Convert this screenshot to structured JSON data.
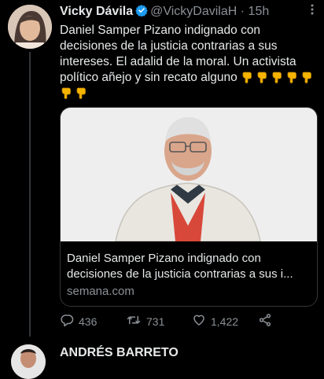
{
  "tweet": {
    "author": "Vicky Dávila",
    "handle": "@VickyDavilaH",
    "separator": "·",
    "time": "15h",
    "text_main": "Daniel Samper Pizano indignado con decisiones de la justicia contrarias a sus intereses. El adalid  de la moral. Un activista político añejo y sin recato alguno",
    "emoji_count": 7,
    "card": {
      "title": "Daniel Samper Pizano indignado con decisiones de la justicia contrarias a sus i...",
      "domain": "semana.com"
    },
    "replies": "436",
    "retweets": "731",
    "likes": "1,422"
  },
  "next_tweet": {
    "author": "ANDRÉS BARRETO"
  },
  "colors": {
    "background": "#000000",
    "text": "#e7e9ea",
    "muted": "#8b9095",
    "verified": "#1d9bf0",
    "border": "#333639"
  }
}
